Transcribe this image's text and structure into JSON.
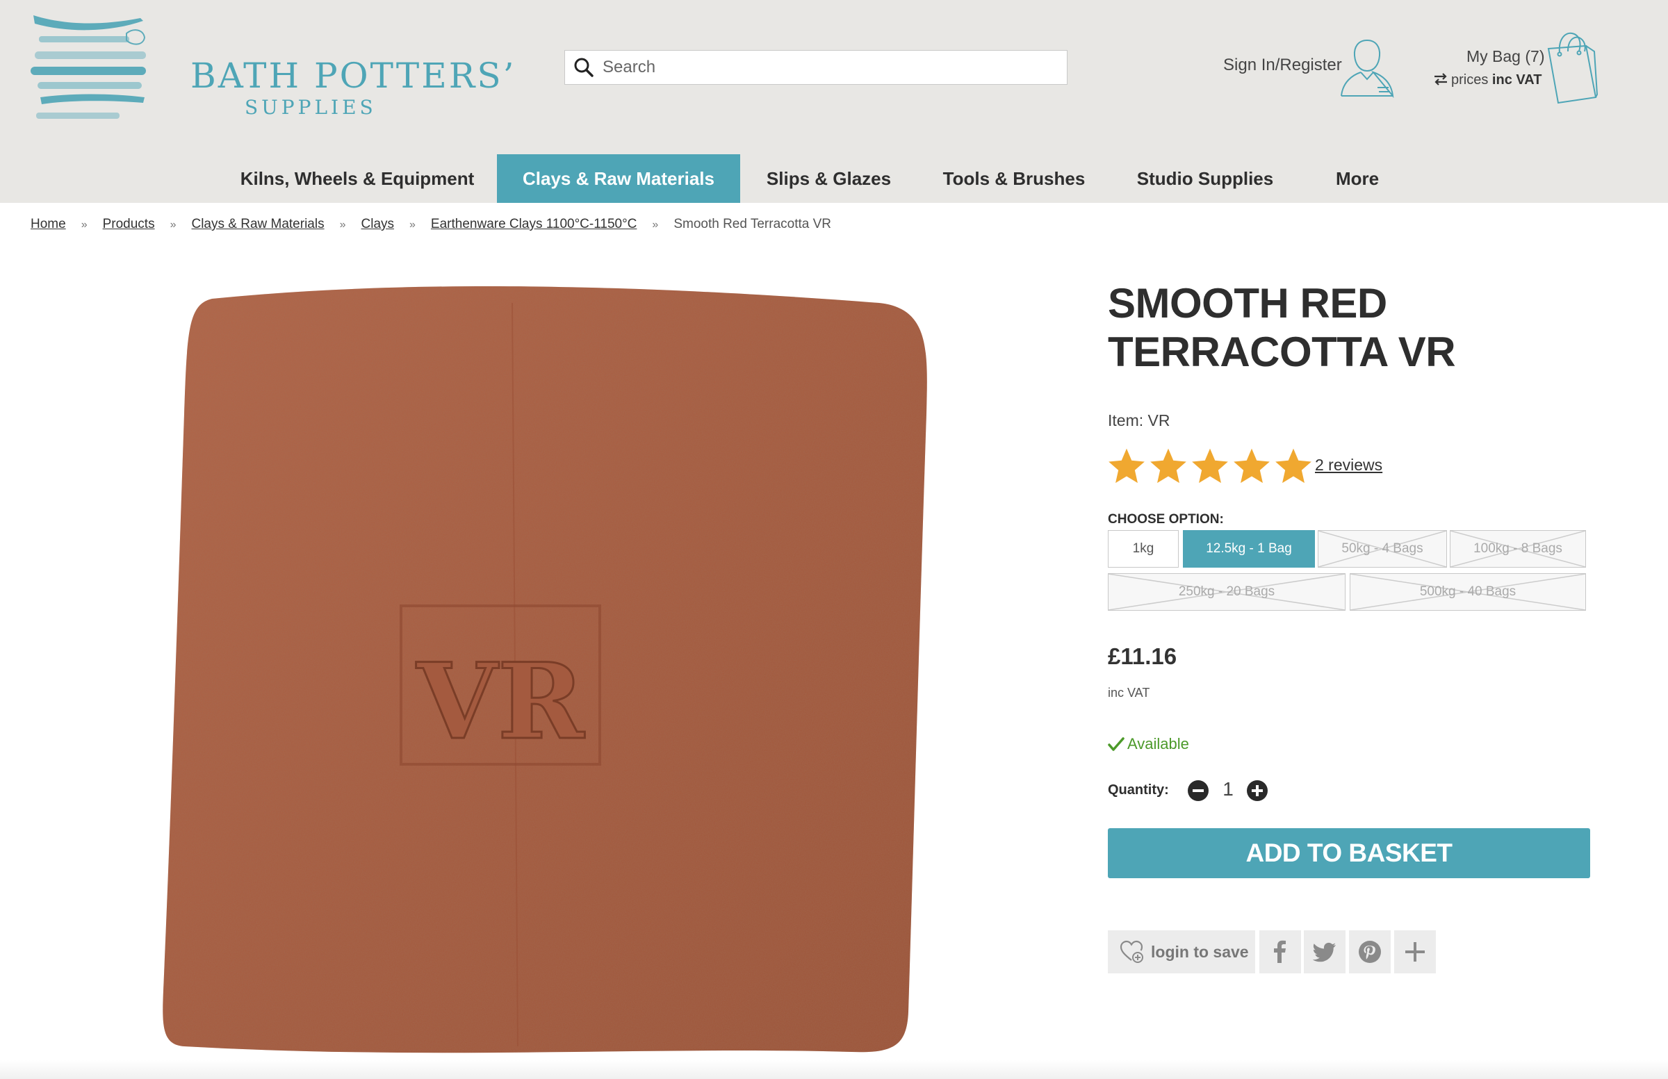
{
  "header": {
    "logo": {
      "line1": "BATH POTTERS’",
      "line2": "SUPPLIES"
    },
    "search": {
      "placeholder": "Search"
    },
    "account": {
      "signin_label": "Sign In/Register"
    },
    "bag": {
      "label": "My Bag (7)",
      "vat_prefix": "prices",
      "vat_value": "inc VAT"
    },
    "accent_color": "#4ea5b6"
  },
  "nav": {
    "items": [
      {
        "label": "Kilns, Wheels & Equipment",
        "active": false
      },
      {
        "label": "Clays & Raw Materials",
        "active": true
      },
      {
        "label": "Slips & Glazes",
        "active": false
      },
      {
        "label": "Tools & Brushes",
        "active": false
      },
      {
        "label": "Studio Supplies",
        "active": false
      },
      {
        "label": "More",
        "active": false
      }
    ]
  },
  "breadcrumb": {
    "items": [
      "Home",
      "Products",
      "Clays & Raw Materials",
      "Clays",
      "Earthenware Clays 1100°C-1150°C"
    ],
    "separator": "»",
    "current": "Smooth Red Terracotta VR"
  },
  "product": {
    "image_stamp": "VR",
    "title": "SMOOTH RED TERRACOTTA VR",
    "item_code": "Item: VR",
    "rating": 5,
    "rating_max": 5,
    "reviews_link": "2 reviews",
    "choose_label": "CHOOSE OPTION:",
    "options": [
      {
        "label": "1kg",
        "state": "available"
      },
      {
        "label": "12.5kg - 1 Bag",
        "state": "selected"
      },
      {
        "label": "50kg - 4 Bags",
        "state": "unavailable"
      },
      {
        "label": "100kg - 8 Bags",
        "state": "unavailable"
      },
      {
        "label": "250kg - 20 Bags",
        "state": "unavailable"
      },
      {
        "label": "500kg - 40 Bags",
        "state": "unavailable"
      }
    ],
    "price": "£11.16",
    "price_note": "inc VAT",
    "availability": "Available",
    "availability_color": "#4c9a2a",
    "quantity_label": "Quantity:",
    "quantity": "1",
    "add_to_basket": "ADD TO BASKET",
    "save_label": "login to save",
    "share_icons": [
      "facebook-icon",
      "twitter-icon",
      "pinterest-icon",
      "plus-icon"
    ],
    "star_color": "#f0a830"
  }
}
